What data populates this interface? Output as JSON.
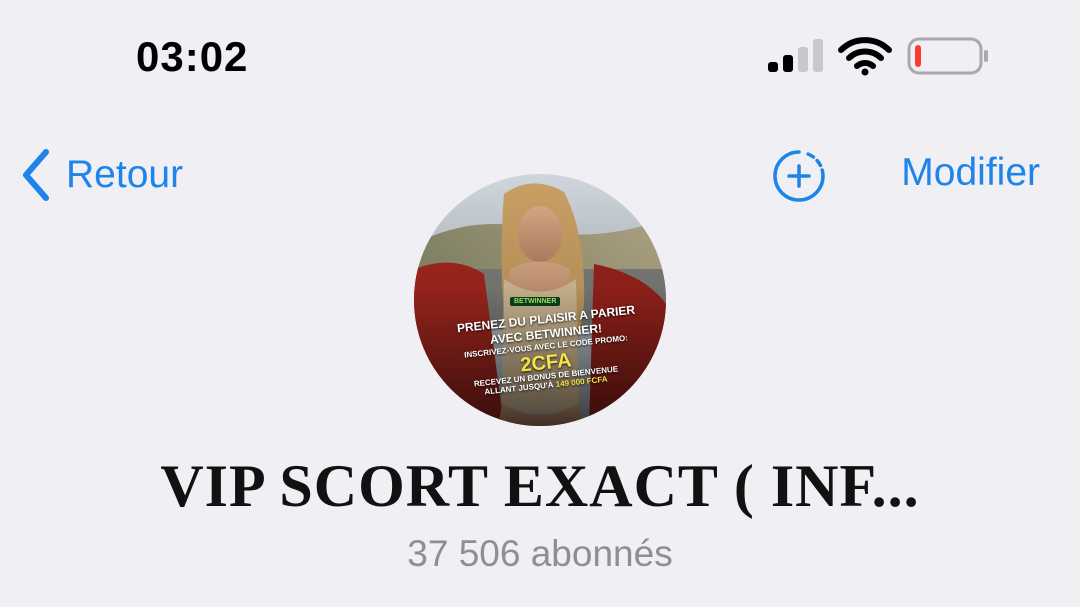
{
  "status_bar": {
    "time": "03:02",
    "signal_icon": "cellular-signal-icon",
    "wifi_icon": "wifi-icon",
    "battery_icon": "battery-low-icon",
    "signal_bars_active": 2,
    "signal_bars_total": 4,
    "battery_level": 0.1,
    "battery_color": "#ff3b30"
  },
  "nav": {
    "back_label": "Retour",
    "back_icon": "chevron-left-icon",
    "add_story_icon": "add-story-icon",
    "edit_label": "Modifier",
    "accent_color": "#1f84ea"
  },
  "channel": {
    "avatar_icon": "channel-avatar",
    "avatar_text": {
      "tag": "BETWINNER",
      "line1": "PRENEZ DU PLAISIR A PARIER",
      "line2": "AVEC BETWINNER!",
      "line3": "INSCRIVEZ-VOUS AVEC LE CODE PROMO:",
      "code": "2CFA",
      "line4": "RECEVEZ UN BONUS DE BIENVENUE",
      "line5": "ALLANT JUSQU'À",
      "amount": "149 000 FCFA"
    },
    "title": "VIP SCORT EXACT ( INF...",
    "subscribers": "37 506 abonnés"
  }
}
